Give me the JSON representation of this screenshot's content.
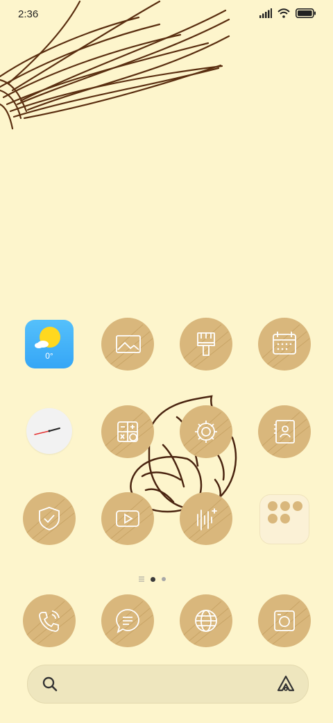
{
  "status_bar": {
    "time": "2:36",
    "icons": [
      "signal-icon",
      "wifi-icon",
      "battery-icon"
    ]
  },
  "home": {
    "weather": {
      "temperature": "0°",
      "icon": "partly-cloudy-icon"
    },
    "apps_row1": [
      "weather-widget",
      "gallery-icon",
      "themes-icon",
      "calendar-icon"
    ],
    "apps_row2": [
      "clock-widget",
      "calculator-icon",
      "settings-icon",
      "contacts-icon"
    ],
    "apps_row3": [
      "security-icon",
      "video-icon",
      "recorder-icon",
      "folder"
    ],
    "page_indicator": {
      "pages": 2,
      "current": 1
    }
  },
  "dock": [
    "phone-icon",
    "messages-icon",
    "browser-icon",
    "camera-icon"
  ],
  "search_bar": {
    "icons": [
      "search-icon",
      "assistant-icon"
    ]
  },
  "colors": {
    "background": "#fdf5cc",
    "icon_fill": "#d9b77c",
    "sketch": "#5a2e10",
    "weather_bg": "#35a6f6"
  }
}
